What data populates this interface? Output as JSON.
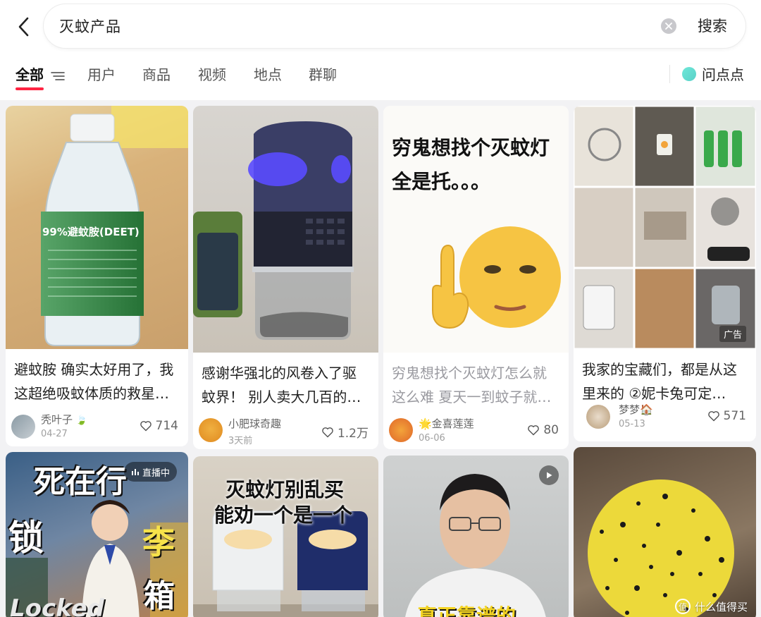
{
  "search": {
    "query": "灭蚊产品",
    "button_label": "搜索"
  },
  "tabs": [
    {
      "label": "全部"
    },
    {
      "label": "用户"
    },
    {
      "label": "商品"
    },
    {
      "label": "视频"
    },
    {
      "label": "地点"
    },
    {
      "label": "群聊"
    }
  ],
  "ask": {
    "label": "问点点"
  },
  "colors": {
    "accent": "#ff2442",
    "ask_dot": "#5ad1c8"
  },
  "cards": [
    {
      "image_label": "99%避蚊胺(DEET)",
      "caption": "避蚊胺 确实太好用了，我这超绝吸蚊体质的救星…",
      "author": "秃叶子",
      "date": "04-27",
      "likes": "714"
    },
    {
      "caption": "感谢华强北的风卷入了驱蚊界！ 别人卖大几百的…",
      "author": "小肥球奇趣",
      "date": "3天前",
      "likes": "1.2万"
    },
    {
      "overlay_line1": "穷鬼想找个灭蚊灯",
      "overlay_line2": "全是托。。。",
      "caption": "穷鬼想找个灭蚊灯怎么就这么难 夏天一到蚊子就…",
      "author": "🌟金喜莲莲",
      "date": "06-06",
      "likes": "80"
    },
    {
      "ad_label": "广告",
      "caption": "我家的宝藏们，都是从这里来的 ②妮卡兔可定…",
      "author": "梦梦🏠",
      "date": "05-13",
      "likes": "571"
    },
    {
      "live_label": "直播中",
      "overlay_line1": "死在行",
      "overlay_line2": "锁",
      "overlay_line3": "李",
      "overlay_line4": "箱",
      "overlay_line5": "Locked"
    },
    {
      "overlay_line1": "灭蚊灯别乱买",
      "overlay_line2": "能劝一个是一个"
    },
    {
      "overlay_bottom": "真正靠谱的"
    },
    {
      "watermark": "什么值得买"
    }
  ]
}
